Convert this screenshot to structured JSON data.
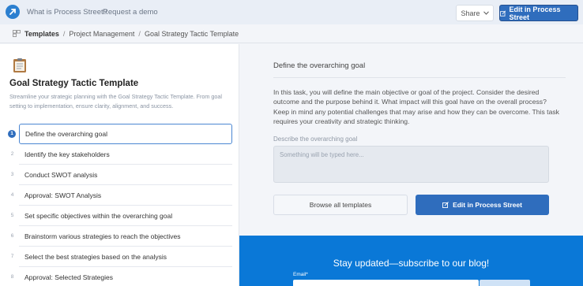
{
  "nav": {
    "what_is": "What is Process Street?",
    "request_demo": "Request a demo",
    "share": "Share",
    "edit_top": "Edit in Process Street"
  },
  "breadcrumb": {
    "root": "Templates",
    "section": "Project Management",
    "current": "Goal Strategy Tactic Template",
    "separator": "/"
  },
  "template": {
    "title": "Goal Strategy Tactic Template",
    "description": "Streamline your strategic planning with the Goal Strategy Tactic Template. From goal setting to implementation, ensure clarity, alignment, and success."
  },
  "tasks": [
    {
      "num": "1",
      "label": "Define the overarching goal"
    },
    {
      "num": "2",
      "label": "Identify the key stakeholders"
    },
    {
      "num": "3",
      "label": "Conduct SWOT analysis"
    },
    {
      "num": "4",
      "label": "Approval: SWOT Analysis"
    },
    {
      "num": "5",
      "label": "Set specific objectives within the overarching goal"
    },
    {
      "num": "6",
      "label": "Brainstorm various strategies to reach the objectives"
    },
    {
      "num": "7",
      "label": "Select the best strategies based on the analysis"
    },
    {
      "num": "8",
      "label": "Approval: Selected Strategies"
    }
  ],
  "detail": {
    "heading": "Define the overarching goal",
    "body": "In this task, you will define the main objective or goal of the project. Consider the desired outcome and the purpose behind it. What impact will this goal have on the overall process? Keep in mind any potential challenges that may arise and how they can be overcome. This task requires your creativity and strategic thinking.",
    "field_label": "Describe the overarching goal",
    "field_placeholder": "Something will be typed here...",
    "browse_label": "Browse all templates",
    "edit_label": "Edit in Process Street"
  },
  "subscribe": {
    "title": "Stay updated—subscribe to our blog!",
    "email_label": "Email*"
  },
  "colors": {
    "brand_blue": "#2f6dbd",
    "subscribe_bg": "#0a78d7"
  }
}
